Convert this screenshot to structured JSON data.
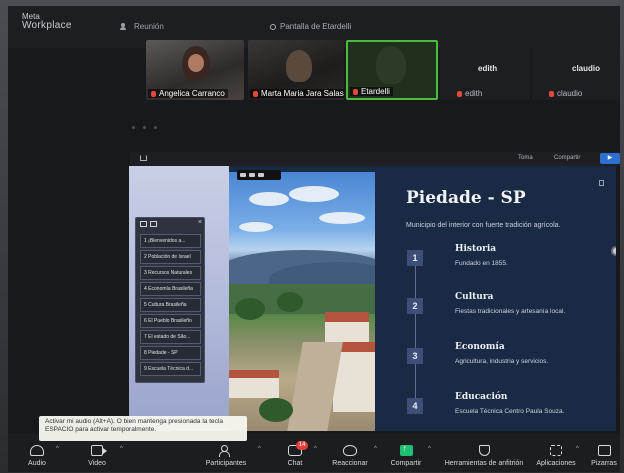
{
  "topbar": {
    "brand_line1": "Meta",
    "brand_line2": "Workplace",
    "meeting_label": "Reunión",
    "screen_owner": "Pantalla de Etardelli"
  },
  "participants": [
    {
      "name": "Angelica Carranco",
      "mic": "muted"
    },
    {
      "name": "Marta Maria Jara Salas",
      "mic": "muted"
    },
    {
      "name": "Etardelli",
      "mic": "muted",
      "active_speaker": true
    },
    {
      "name": "edith",
      "display_name": "edith",
      "mic": "muted"
    },
    {
      "name": "claudio",
      "display_name": "claudio",
      "mic": "muted"
    }
  ],
  "editor": {
    "toma": "Toma",
    "compartir": "Compartir",
    "share_button": "▶"
  },
  "slide": {
    "title": "Piedade - SP",
    "subtitle": "Municipio del interior con fuerte tradición agrícola.",
    "items": [
      {
        "num": "1",
        "title": "Historia",
        "desc": "Fundado en 1855."
      },
      {
        "num": "2",
        "title": "Cultura",
        "desc": "Fiestas tradicionales y artesanía local."
      },
      {
        "num": "3",
        "title": "Economía",
        "desc": "Agricultura, industria y servicios."
      },
      {
        "num": "4",
        "title": "Educación",
        "desc": "Escuela Técnica Centro Paula Souza."
      }
    ]
  },
  "outline": {
    "close": "×",
    "rows": [
      "1 ¡Bienvenidos a...",
      "2 Población de Israel",
      "3 Recursos Naturales",
      "4 Economía Brasileña",
      "5 Cultura Brasileña",
      "6 El Pueblo Brasileño",
      "7 El estado de São...",
      "8 Piedade - SP",
      "9 Escuela Técnica d..."
    ]
  },
  "tooltip": {
    "text": "Activar mi audio (Alt+A). O bien mantenga presionada la tecla ESPACIO para activar temporalmente."
  },
  "bottombar": {
    "audio": "Audio",
    "video": "Video",
    "participants": "Participantes",
    "chat": "Chat",
    "chat_badge": "14",
    "react": "Reaccionar",
    "share": "Compartir",
    "host_tools": "Herramientas de anfitrión",
    "apps": "Aplicaciones",
    "whiteboard": "Pizarras"
  }
}
